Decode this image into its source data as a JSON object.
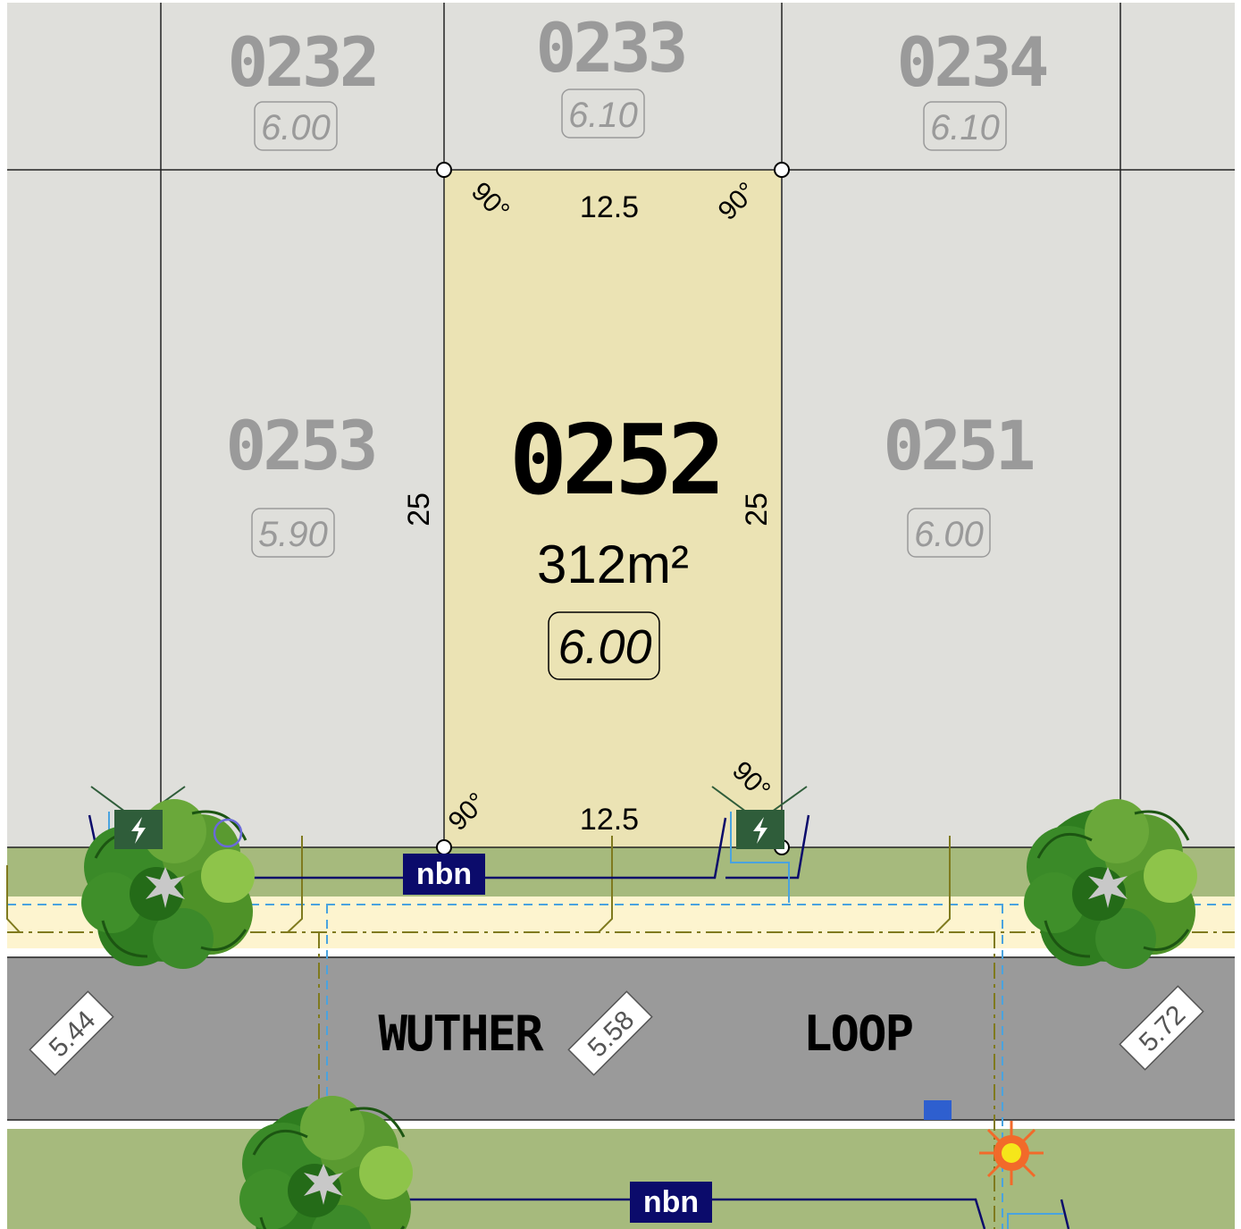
{
  "lots": {
    "l0232": {
      "number": "0232",
      "level": "6.00"
    },
    "l0233": {
      "number": "0233",
      "level": "6.10"
    },
    "l0234": {
      "number": "0234",
      "level": "6.10"
    },
    "l0253": {
      "number": "0253",
      "level": "5.90"
    },
    "l0251": {
      "number": "0251",
      "level": "6.00"
    },
    "l0252": {
      "number": "0252",
      "level": "6.00",
      "area": "312m²"
    }
  },
  "dimensions": {
    "frontage_top": "12.5",
    "frontage_bottom": "12.5",
    "depth_left": "25",
    "depth_right": "25",
    "angle": "90°"
  },
  "street": {
    "name_part1": "WUTHER",
    "name_part2": "LOOP",
    "levels": {
      "left": "5.44",
      "middle": "5.58",
      "right": "5.72"
    }
  },
  "utilities": {
    "nbn_label": "nbn"
  },
  "colors": {
    "neighbour_lot": "#dfdfdb",
    "selected_lot": "#ebe3b4",
    "verge": "#a6ba7d",
    "footpath": "#fdf4cf",
    "road": "#9a9a9a",
    "nbn": "#0b0b6b",
    "water": "#4aa3df",
    "sewer": "#8b7d1e",
    "power_pit": "#2f5d3a",
    "streetlight": "#f26a2a"
  },
  "icons": [
    "power-pit-icon",
    "nbn-pit-icon",
    "tree-icon",
    "streetlight-icon",
    "hydrant-icon"
  ]
}
